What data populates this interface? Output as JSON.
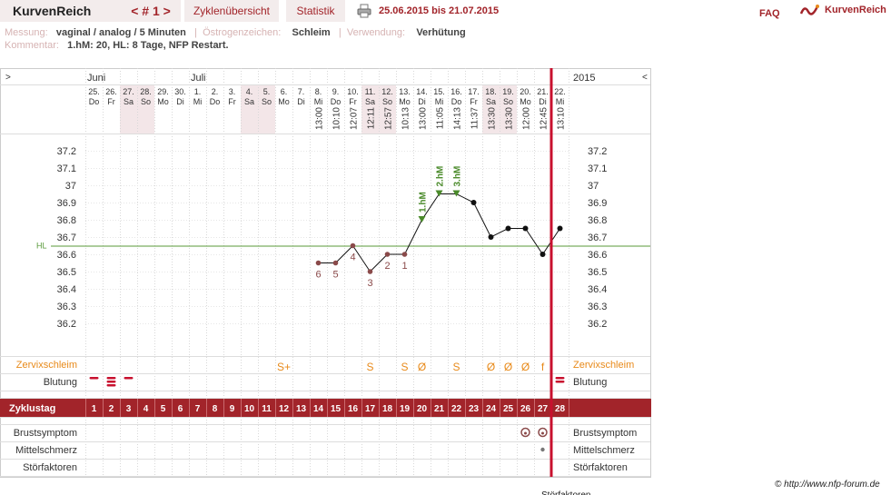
{
  "app": {
    "title": "KurvenReich",
    "brand": "KurvenReich"
  },
  "nav": {
    "cycle_label": "< # 1 >",
    "tab_overview": "Zyklenübersicht",
    "tab_stats": "Statistik",
    "date_range": "25.06.2015 bis 21.07.2015",
    "faq": "FAQ"
  },
  "meta": {
    "measure_label": "Messung:",
    "measure_value": "vaginal / analog / 5 Minuten",
    "estrogen_label": "Östrogenzeichen:",
    "estrogen_value": "Schleim",
    "usage_label": "Verwendung:",
    "usage_value": "Verhütung",
    "comment_label": "Kommentar:",
    "comment_value": "1.hM: 20,  HL: 8 Tage,  NFP Restart."
  },
  "chart": {
    "year": "2015",
    "left_arrow": ">",
    "right_arrow": "<",
    "months": [
      {
        "label": "Juni",
        "day_index": 0
      },
      {
        "label": "Juli",
        "day_index": 6
      }
    ],
    "days": [
      {
        "d": "25.",
        "w": "Do",
        "t": "",
        "shade": false
      },
      {
        "d": "26.",
        "w": "Fr",
        "t": "",
        "shade": false
      },
      {
        "d": "27.",
        "w": "Sa",
        "t": "",
        "shade": true
      },
      {
        "d": "28.",
        "w": "So",
        "t": "",
        "shade": true
      },
      {
        "d": "29.",
        "w": "Mo",
        "t": "",
        "shade": false
      },
      {
        "d": "30.",
        "w": "Di",
        "t": "",
        "shade": false
      },
      {
        "d": "1.",
        "w": "Mi",
        "t": "",
        "shade": false
      },
      {
        "d": "2.",
        "w": "Do",
        "t": "",
        "shade": false
      },
      {
        "d": "3.",
        "w": "Fr",
        "t": "",
        "shade": false
      },
      {
        "d": "4.",
        "w": "Sa",
        "t": "",
        "shade": true
      },
      {
        "d": "5.",
        "w": "So",
        "t": "",
        "shade": true
      },
      {
        "d": "6.",
        "w": "Mo",
        "t": "",
        "shade": false
      },
      {
        "d": "7.",
        "w": "Di",
        "t": "",
        "shade": false
      },
      {
        "d": "8.",
        "w": "Mi",
        "t": "13:00",
        "shade": false
      },
      {
        "d": "9.",
        "w": "Do",
        "t": "10:10",
        "shade": false
      },
      {
        "d": "10.",
        "w": "Fr",
        "t": "12:07",
        "shade": false
      },
      {
        "d": "11.",
        "w": "Sa",
        "t": "12:11",
        "shade": true
      },
      {
        "d": "12.",
        "w": "So",
        "t": "12:57",
        "shade": true
      },
      {
        "d": "13.",
        "w": "Mo",
        "t": "10:13",
        "shade": false
      },
      {
        "d": "14.",
        "w": "Di",
        "t": "13:00",
        "shade": false
      },
      {
        "d": "15.",
        "w": "Mi",
        "t": "11:05",
        "shade": false
      },
      {
        "d": "16.",
        "w": "Do",
        "t": "14:13",
        "shade": false
      },
      {
        "d": "17.",
        "w": "Fr",
        "t": "11:37",
        "shade": false
      },
      {
        "d": "18.",
        "w": "Sa",
        "t": "13:30",
        "shade": true
      },
      {
        "d": "19.",
        "w": "So",
        "t": "13:30",
        "shade": true
      },
      {
        "d": "20.",
        "w": "Mo",
        "t": "12:00",
        "shade": false
      },
      {
        "d": "21.",
        "w": "Di",
        "t": "12:45",
        "shade": false
      },
      {
        "d": "22.",
        "w": "Mi",
        "t": "13:10",
        "shade": false
      }
    ],
    "y_ticks": [
      "37.2",
      "37.1",
      "37",
      "36.9",
      "36.8",
      "36.7",
      "36.6",
      "36.5",
      "36.4",
      "36.3",
      "36.2"
    ],
    "hl_label": "HL",
    "hl_value": 36.65,
    "temps": [
      null,
      null,
      null,
      null,
      null,
      null,
      null,
      null,
      null,
      null,
      null,
      null,
      null,
      36.55,
      36.55,
      36.65,
      36.5,
      36.6,
      36.6,
      36.8,
      36.95,
      36.95,
      36.9,
      36.7,
      36.75,
      36.75,
      36.6,
      36.75
    ],
    "low_labels": [
      {
        "i": 13,
        "t": "6"
      },
      {
        "i": 14,
        "t": "5"
      },
      {
        "i": 15,
        "t": "4"
      },
      {
        "i": 16,
        "t": "3"
      },
      {
        "i": 17,
        "t": "2"
      },
      {
        "i": 18,
        "t": "1"
      }
    ],
    "high_labels": [
      {
        "i": 19,
        "t": "1.hM"
      },
      {
        "i": 20,
        "t": "2.hM"
      },
      {
        "i": 21,
        "t": "3.hM"
      }
    ],
    "rows": {
      "cervix": "Zervixschleim",
      "bleeding": "Blutung",
      "cycle_day": "Zyklustag",
      "breast": "Brustsymptom",
      "midpain": "Mittelschmerz",
      "disturb": "Störfaktoren"
    },
    "cervix_marks": [
      {
        "i": 11,
        "t": "S+"
      },
      {
        "i": 16,
        "t": "S"
      },
      {
        "i": 18,
        "t": "S"
      },
      {
        "i": 19,
        "t": "Ø"
      },
      {
        "i": 21,
        "t": "S"
      },
      {
        "i": 23,
        "t": "Ø"
      },
      {
        "i": 24,
        "t": "Ø"
      },
      {
        "i": 25,
        "t": "Ø"
      },
      {
        "i": 26,
        "t": "f"
      }
    ],
    "bleeding_marks": [
      {
        "i": 0,
        "n": 1
      },
      {
        "i": 1,
        "n": 3
      },
      {
        "i": 2,
        "n": 1
      },
      {
        "i": 27,
        "n": 2
      }
    ],
    "cycle_days": [
      "1",
      "2",
      "3",
      "4",
      "5",
      "6",
      "7",
      "8",
      "9",
      "10",
      "11",
      "12",
      "13",
      "14",
      "15",
      "16",
      "17",
      "18",
      "19",
      "20",
      "21",
      "22",
      "23",
      "24",
      "25",
      "26",
      "27",
      "28"
    ],
    "breast_marks": [
      25,
      26
    ],
    "midpain_marks": [
      26
    ],
    "current_day_index": 26
  },
  "footer": {
    "copyright": "© http://www.nfp-forum.de",
    "cut_text": "Störfaktoren"
  },
  "colors": {
    "accent": "#a2242a",
    "shade": "#f3e6e8",
    "grid": "#c8c8c8",
    "cervix": "#e88a1a",
    "hl": "#5a9a3a",
    "green": "#4a8a2a",
    "low": "#8a4a4a"
  }
}
